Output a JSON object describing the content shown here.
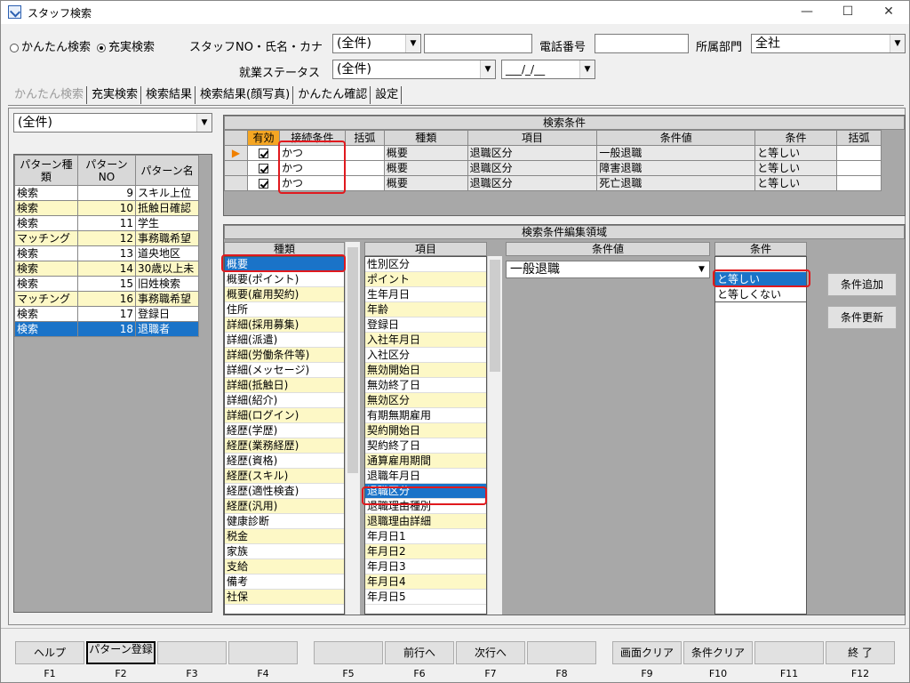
{
  "window": {
    "title": "スタッフ検索",
    "min": "—",
    "max": "☐",
    "close": "✕"
  },
  "search": {
    "radio_simple": "かんたん検索",
    "radio_full": "充実検索",
    "name_label": "スタッフNO・氏名・カナ",
    "name_combo": "(全件)",
    "phone_label": "電話番号",
    "dept_label": "所属部門",
    "dept_value": "全社",
    "status_label": "就業ステータス",
    "status_value": "(全件)",
    "date_value": "___/_/__"
  },
  "tabs": [
    "かんたん検索",
    "充実検索",
    "検索結果",
    "検索結果(顔写真)",
    "かんたん確認",
    "設定"
  ],
  "left": {
    "combo": "(全件)",
    "headers": [
      "パターン種類",
      "パターンNO",
      "パターン名"
    ],
    "rows": [
      [
        "検索",
        "9",
        "スキル上位"
      ],
      [
        "検索",
        "10",
        "抵触日確認"
      ],
      [
        "検索",
        "11",
        "学生"
      ],
      [
        "マッチング",
        "12",
        "事務職希望"
      ],
      [
        "検索",
        "13",
        "道央地区"
      ],
      [
        "検索",
        "14",
        "30歳以上未"
      ],
      [
        "検索",
        "15",
        "旧姓検索"
      ],
      [
        "マッチング",
        "16",
        "事務職希望"
      ],
      [
        "検索",
        "17",
        "登録日"
      ],
      [
        "検索",
        "18",
        "退職者"
      ]
    ]
  },
  "conditions": {
    "title": "検索条件",
    "headers": [
      "有効",
      "接続条件",
      "括弧",
      "種類",
      "項目",
      "条件値",
      "条件",
      "括弧"
    ],
    "rows": [
      [
        "かつ",
        "",
        "概要",
        "退職区分",
        "一般退職",
        "と等しい",
        ""
      ],
      [
        "かつ",
        "",
        "概要",
        "退職区分",
        "障害退職",
        "と等しい",
        ""
      ],
      [
        "かつ",
        "",
        "概要",
        "退職区分",
        "死亡退職",
        "と等しい",
        ""
      ]
    ]
  },
  "edit": {
    "title": "検索条件編集領域",
    "col_kind": "種類",
    "col_item": "項目",
    "col_value": "条件値",
    "col_cond": "条件",
    "kinds": [
      "概要",
      "概要(ポイント)",
      "概要(雇用契約)",
      "住所",
      "詳細(採用募集)",
      "詳細(派遣)",
      "詳細(労働条件等)",
      "詳細(メッセージ)",
      "詳細(抵触日)",
      "詳細(紹介)",
      "詳細(ログイン)",
      "経歴(学歴)",
      "経歴(業務経歴)",
      "経歴(資格)",
      "経歴(スキル)",
      "経歴(適性検査)",
      "経歴(汎用)",
      "健康診断",
      "税金",
      "家族",
      "支給",
      "備考",
      "社保"
    ],
    "items": [
      "性別区分",
      "ポイント",
      "生年月日",
      "年齢",
      "登録日",
      "入社年月日",
      "入社区分",
      "無効開始日",
      "無効終了日",
      "無効区分",
      "有期無期雇用",
      "契約開始日",
      "契約終了日",
      "通算雇用期間",
      "退職年月日",
      "退職区分",
      "退職理由種別",
      "退職理由詳細",
      "年月日1",
      "年月日2",
      "年月日3",
      "年月日4",
      "年月日5"
    ],
    "value": "一般退職",
    "conds": [
      "",
      "と等しい",
      "と等しくない"
    ],
    "add_button": "条件追加",
    "update_button": "条件更新"
  },
  "fkeys": [
    {
      "label": "ヘルプ",
      "key": "F1"
    },
    {
      "label": "パターン登録",
      "key": "F2"
    },
    {
      "label": "",
      "key": "F3"
    },
    {
      "label": "",
      "key": "F4"
    },
    {
      "label": "",
      "key": "F5"
    },
    {
      "label": "前行へ",
      "key": "F6"
    },
    {
      "label": "次行へ",
      "key": "F7"
    },
    {
      "label": "",
      "key": "F8"
    },
    {
      "label": "画面クリア",
      "key": "F9"
    },
    {
      "label": "条件クリア",
      "key": "F10"
    },
    {
      "label": "",
      "key": "F11"
    },
    {
      "label": "終 了",
      "key": "F12"
    }
  ],
  "colors": {
    "selection": "#1a73c8",
    "highlight_row": "#fdf8c6",
    "annotation": "#e0191e"
  }
}
